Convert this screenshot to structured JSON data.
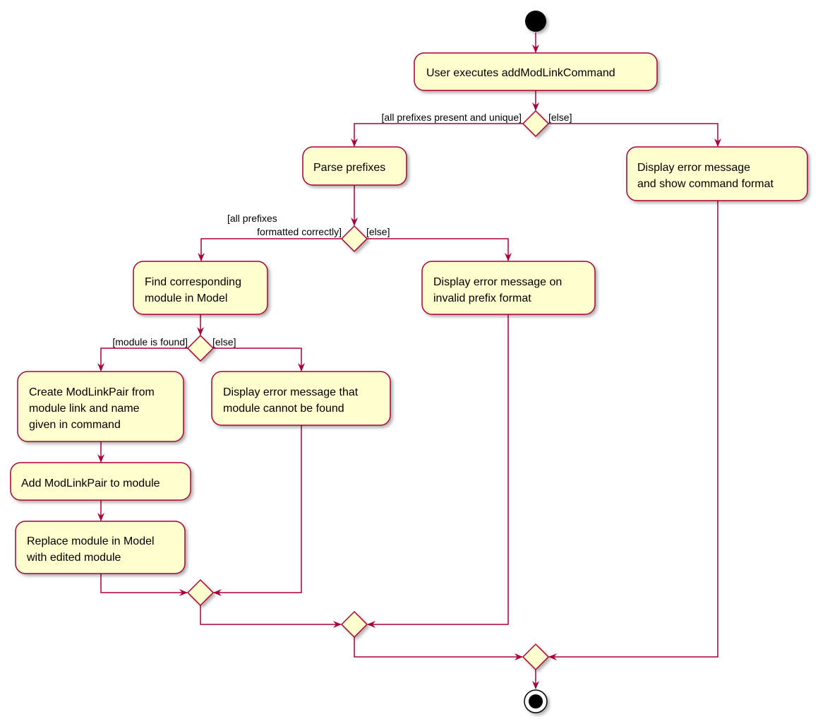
{
  "colors": {
    "fill": "#FEFECE",
    "border": "#A80036",
    "text": "#000000"
  },
  "nodes": {
    "user_executes": [
      "User executes addModLinkCommand"
    ],
    "parse_prefixes": [
      "Parse prefixes"
    ],
    "error_command_format": [
      "Display error message",
      "and show command format"
    ],
    "find_module": [
      "Find corresponding",
      "module in Model"
    ],
    "error_prefix_format": [
      "Display error message on",
      "invalid prefix format"
    ],
    "create_pair": [
      "Create ModLinkPair from",
      "module link and name",
      "given in command"
    ],
    "error_not_found": [
      "Display error message that",
      "module cannot be found"
    ],
    "add_pair": [
      "Add ModLinkPair to module"
    ],
    "replace_module": [
      "Replace module in Model",
      "with edited module"
    ]
  },
  "guards": {
    "prefixes_present": "[all prefixes present and unique]",
    "prefixes_else": "[else]",
    "formatted_1": "[all prefixes",
    "formatted_2": "formatted correctly]",
    "formatted_else": "[else]",
    "found": "[module is found]",
    "found_else": "[else]"
  }
}
